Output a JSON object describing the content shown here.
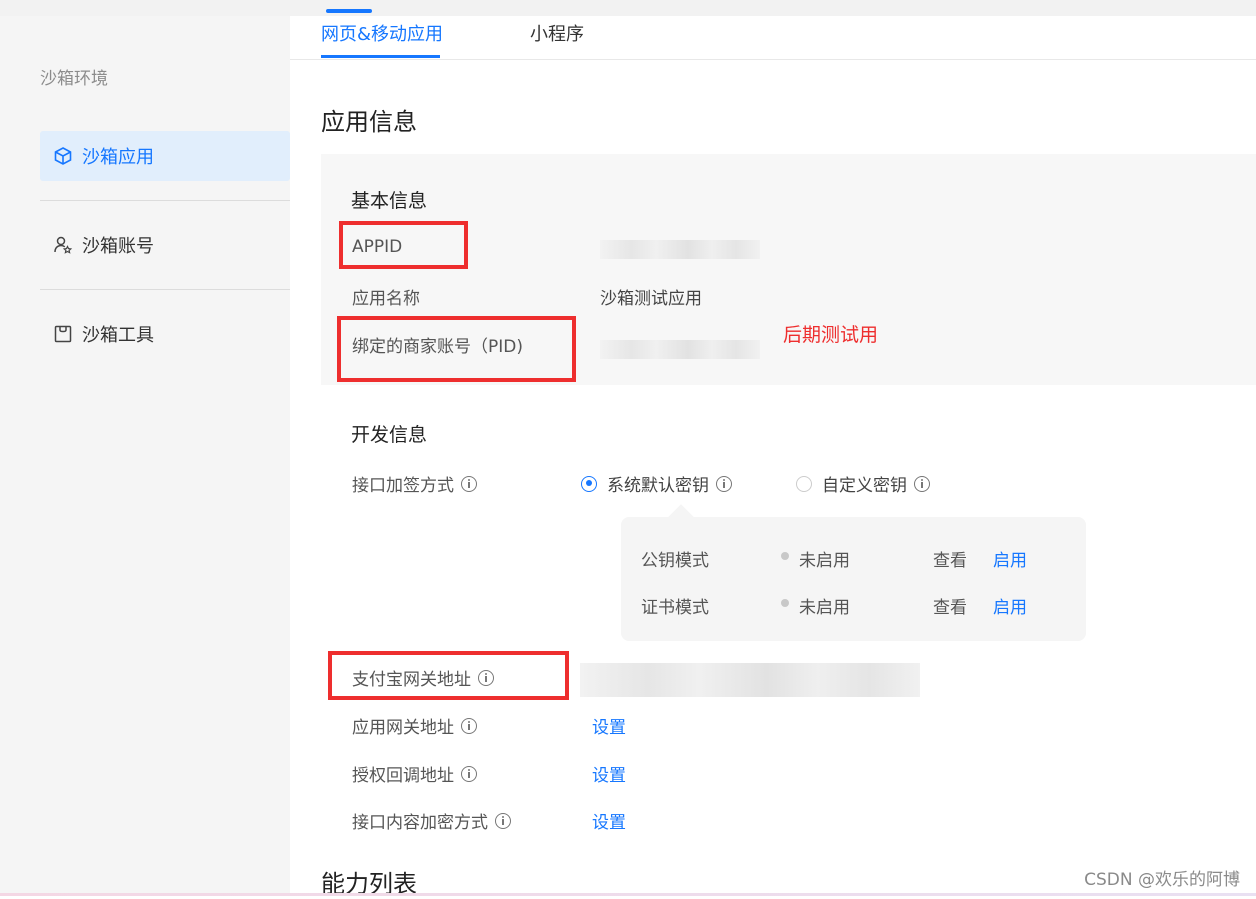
{
  "sidebar": {
    "title": "沙箱环境",
    "items": [
      {
        "label": "沙箱应用",
        "icon": "cube-icon",
        "active": true
      },
      {
        "label": "沙箱账号",
        "icon": "user-star-icon",
        "active": false
      },
      {
        "label": "沙箱工具",
        "icon": "bag-icon",
        "active": false
      }
    ]
  },
  "tabs": [
    {
      "label": "网页&移动应用",
      "active": true
    },
    {
      "label": "小程序",
      "active": false
    }
  ],
  "app_info": {
    "title": "应用信息",
    "basic": {
      "title": "基本信息",
      "appid_label": "APPID",
      "name_label": "应用名称",
      "name_value": "沙箱测试应用",
      "pid_label": "绑定的商家账号（PID)",
      "annotation": "后期测试用"
    },
    "dev": {
      "title": "开发信息",
      "sign_label": "接口加签方式",
      "radio_default": "系统默认密钥",
      "radio_custom": "自定义密钥",
      "modes": [
        {
          "name": "公钥模式",
          "status": "未启用",
          "view": "查看",
          "action": "启用"
        },
        {
          "name": "证书模式",
          "status": "未启用",
          "view": "查看",
          "action": "启用"
        }
      ],
      "gateway_label": "支付宝网关地址",
      "app_gateway_label": "应用网关地址",
      "app_gateway_action": "设置",
      "callback_label": "授权回调地址",
      "callback_action": "设置",
      "encrypt_label": "接口内容加密方式",
      "encrypt_action": "设置"
    }
  },
  "capability": {
    "title": "能力列表"
  },
  "watermark": "CSDN @欢乐的阿博",
  "colors": {
    "accent": "#1677ff",
    "annotation_red": "#ee2e2e",
    "sidebar_bg": "#f5f5f5",
    "active_bg": "#e1eefc"
  }
}
